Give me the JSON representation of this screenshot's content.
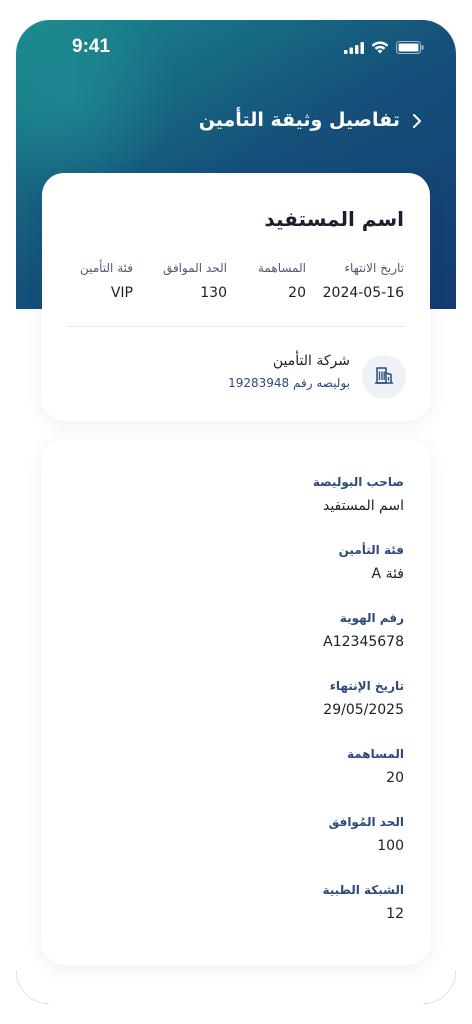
{
  "status_bar": {
    "time": "9:41",
    "icons": [
      "signal-icon",
      "wifi-icon",
      "battery-icon"
    ]
  },
  "header": {
    "title": "تفاصيل وثيقة التأمين",
    "back_icon": "chevron-right-icon"
  },
  "summary": {
    "name": "اسم المستفيد",
    "stats": [
      {
        "label": "تاريخ الانتهاء",
        "value": "2024-05-16"
      },
      {
        "label": "المساهمة",
        "value": "20"
      },
      {
        "label": "الحد الموافق",
        "value": "130"
      },
      {
        "label": "فئة التأمين",
        "value": "VIP"
      }
    ],
    "company": {
      "name": "شركة التأمين",
      "policy": "بوليصه رقم 19283948",
      "icon": "building-icon"
    }
  },
  "details": [
    {
      "label": "صاحب البوليصة",
      "value": "اسم المستفيد"
    },
    {
      "label": "فئة التأمين",
      "value": "فئة A"
    },
    {
      "label": "رقم الهوية",
      "value": "A12345678"
    },
    {
      "label": "تاريخ الإنتهاء",
      "value": "29/05/2025"
    },
    {
      "label": "المساهمة",
      "value": "20"
    },
    {
      "label": "الحد المُوافق",
      "value": "100"
    },
    {
      "label": "الشبكة الطبية",
      "value": "12"
    }
  ],
  "colors": {
    "gradient_start": "#1a8a8e",
    "gradient_end": "#0f2660",
    "label_blue": "#2d4a7c",
    "text_dark": "#1b1f2e"
  }
}
